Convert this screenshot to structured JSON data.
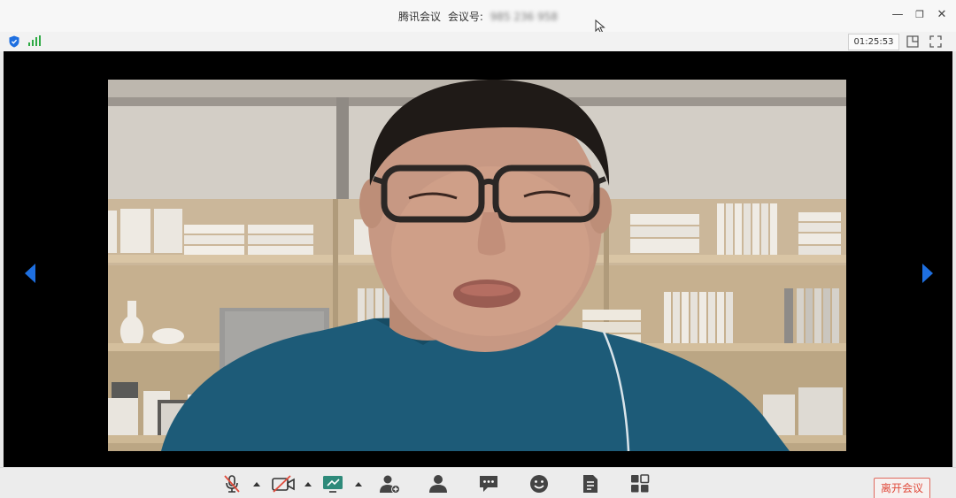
{
  "window": {
    "app_title": "腾讯会议",
    "meeting_id_label": "会议号:",
    "meeting_id_value": "985 236 958",
    "minimize_glyph": "—",
    "restore_glyph": "❐",
    "close_glyph": "✕"
  },
  "infobar": {
    "elapsed_time": "01:25:53",
    "network_signal_bars": 3
  },
  "toolbar": {
    "buttons": [
      {
        "name": "microphone-muted",
        "icon": "mic-off-icon"
      },
      {
        "name": "camera-off",
        "icon": "video-off-icon"
      },
      {
        "name": "share-screen",
        "icon": "screen-share-icon"
      },
      {
        "name": "invite",
        "icon": "add-person-icon"
      },
      {
        "name": "participants",
        "icon": "people-icon"
      },
      {
        "name": "chat",
        "icon": "chat-icon"
      },
      {
        "name": "reactions",
        "icon": "smile-icon"
      },
      {
        "name": "documents",
        "icon": "document-icon"
      },
      {
        "name": "apps",
        "icon": "grid-icon"
      }
    ],
    "leave_label": "离开会议"
  },
  "colors": {
    "accent": "#1e6fe0",
    "danger": "#e04a3a",
    "signal": "#2eaa44"
  }
}
